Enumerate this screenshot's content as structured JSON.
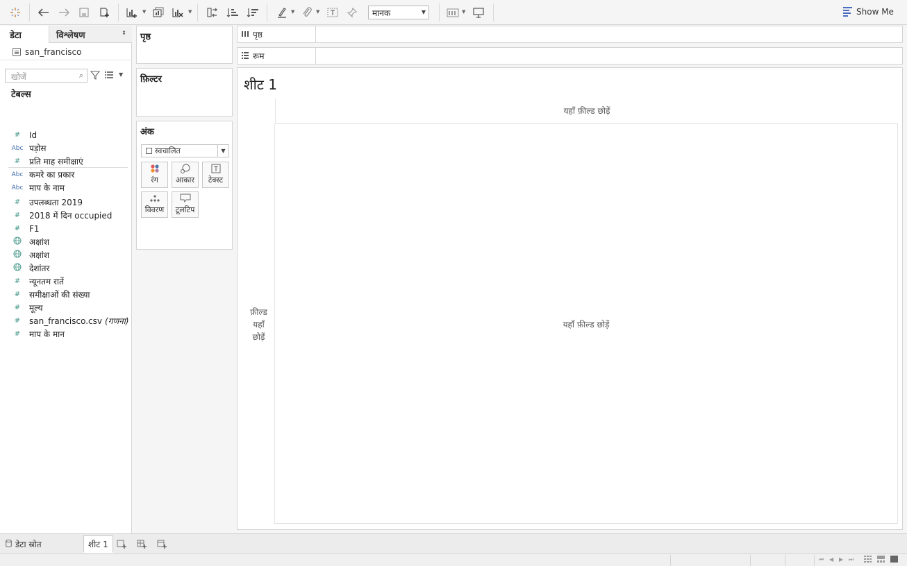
{
  "toolbar": {
    "fit_value": "मानक",
    "show_me_label": "Show Me",
    "icons": [
      "tableau-logo-icon",
      "undo-icon",
      "redo-icon",
      "save-icon",
      "add-datasource-icon",
      "new-worksheet-icon",
      "duplicate-sheet-icon",
      "clear-sheet-icon",
      "swap-icon",
      "sort-ascending-icon",
      "sort-descending-icon",
      "highlight-icon",
      "group-icon",
      "show-labels-icon",
      "pin-icon",
      "show-cards-icon",
      "presentation-icon"
    ]
  },
  "left_pane": {
    "tab_data": "डेटा",
    "tab_analysis": "विश्लेषण",
    "datasource_name": "san_francisco",
    "search_placeholder": "खोजें",
    "tables_heading": "टेबल्स",
    "fields": [
      {
        "type": "#",
        "label": "Id"
      },
      {
        "type": "Abc",
        "label": "पड़ोस"
      },
      {
        "type": "#",
        "label": "प्रति माह समीक्षाएं"
      },
      {
        "type": "Abc",
        "label": "कमरे का प्रकार"
      },
      {
        "type": "Abc",
        "label": "माप के नाम"
      },
      {
        "type": "#",
        "label": "उपलब्धता 2019"
      },
      {
        "type": "#",
        "label": "2018 में दिन occupied"
      },
      {
        "type": "#",
        "label": "F1"
      },
      {
        "type": "globe",
        "label": "अक्षांश"
      },
      {
        "type": "globe",
        "label": "अक्षांश"
      },
      {
        "type": "globe",
        "label": "देशांतर"
      },
      {
        "type": "#",
        "label": "न्यूनतम रातें"
      },
      {
        "type": "#",
        "label": "समीक्षाओं की संख्या"
      },
      {
        "type": "#",
        "label": "मूल्य"
      },
      {
        "type": "#",
        "label": "san_francisco.csv",
        "suffix": "(गणना)"
      },
      {
        "type": "#",
        "label": "माप के मान"
      }
    ]
  },
  "cards": {
    "pages": "पृष्ठ",
    "filters": "फ़िल्टर",
    "marks": "अंक",
    "marks_type": "स्वचालित",
    "mark_buttons": [
      "रंग",
      "आकार",
      "टेक्स्ट",
      "विवरण",
      "टूलटिप"
    ]
  },
  "shelves": {
    "columns": "पृष्ठ",
    "rows": "रूम"
  },
  "worksheet": {
    "title": "शीट 1",
    "drop_top": "यहाँ फ़ील्ड छोड़ें",
    "drop_main": "यहाँ फ़ील्ड छोड़ें",
    "drop_left_1": "फ़ील्ड",
    "drop_left_2": "यहाँ",
    "drop_left_3": "छोड़ें"
  },
  "bottom": {
    "datasource_tab": "डेटा स्रोत",
    "sheet_tab": "शीट 1"
  }
}
